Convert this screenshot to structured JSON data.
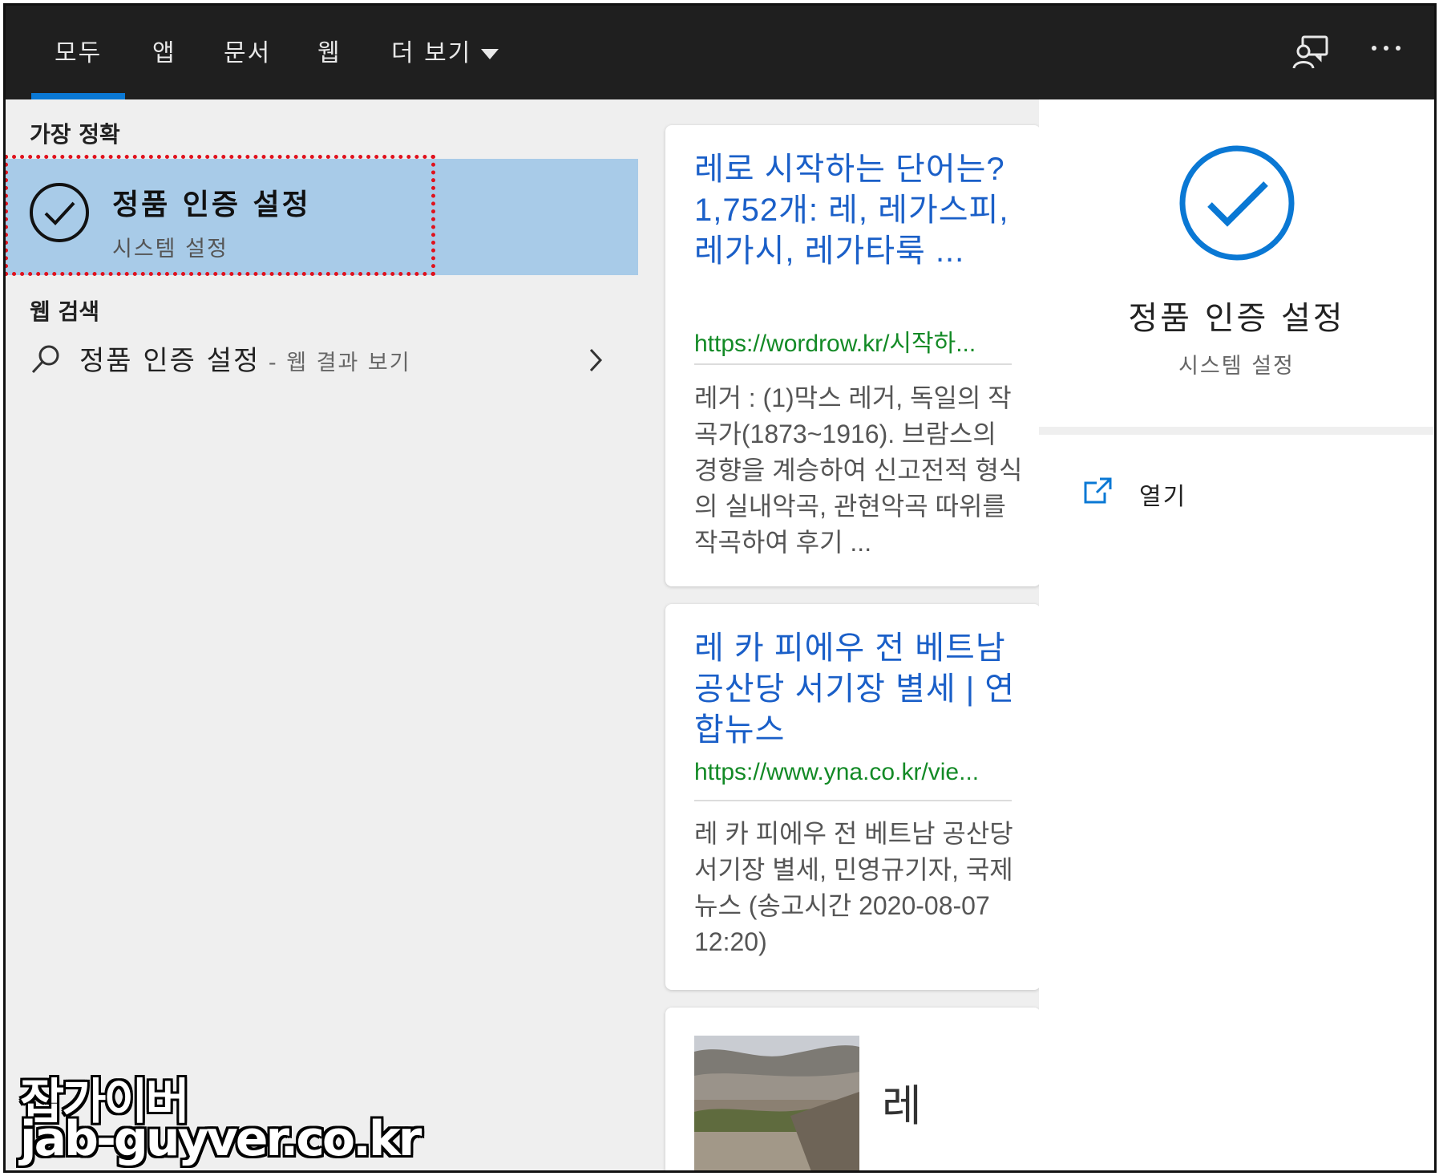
{
  "tabs": [
    {
      "label": "모두",
      "active": true
    },
    {
      "label": "앱"
    },
    {
      "label": "문서"
    },
    {
      "label": "웹"
    },
    {
      "label": "더 보기"
    }
  ],
  "top_icons": [
    "feedback-icon",
    "more-options-icon"
  ],
  "left": {
    "best_match_heading": "가장 정확",
    "best_match": {
      "title": "정품 인증 설정",
      "subtitle": "시스템 설정",
      "icon": "check-circle-icon"
    },
    "web_search_heading": "웹 검색",
    "web_search": {
      "query": "정품 인증 설정",
      "suffix": " - 웹 결과 보기",
      "icon": "search-icon"
    }
  },
  "results": [
    {
      "title": "레로 시작하는 단어는? 1,752개: 레, 레가스피, 레가시, 레가타룩 ...",
      "url": "https://wordrow.kr/시작하...",
      "snippet": "레거 : (1)막스 레거, 독일의 작곡가(1873~1916). 브람스의 경향을 계승하여 신고전적 형식의 실내악곡, 관현악곡 따위를 작곡하여 후기 ..."
    },
    {
      "title": "레 카 피에우 전 베트남 공산당 서기장 별세 | 연합뉴스",
      "url": "https://www.yna.co.kr/vie...",
      "snippet": "레 카 피에우 전 베트남 공산당 서기장 별세, 민영규기자, 국제뉴스 (송고시간 2020-08-07 12:20)"
    },
    {
      "title": "레",
      "image": "landscape-thumbnail"
    }
  ],
  "right": {
    "title": "정품 인증 설정",
    "subtitle": "시스템 설정",
    "open_label": "열기",
    "accent": "#0a78d4"
  },
  "watermark": {
    "line1": "잡가이버",
    "line2": "jab-guyver.co.kr"
  },
  "colors": {
    "topbar": "#1f1f1f",
    "selected": "#a8cbe8",
    "link": "#1a5fc8",
    "url": "#138a26",
    "highlight_border": "#e0121d"
  }
}
